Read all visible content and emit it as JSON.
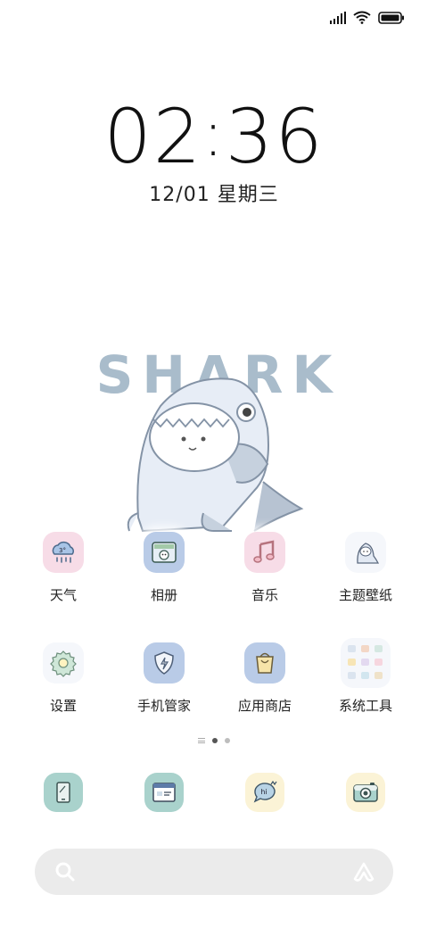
{
  "status_bar": {
    "signal_icon": "cellular-signal-icon",
    "wifi_icon": "wifi-icon",
    "battery_icon": "battery-icon"
  },
  "clock": {
    "hours": "02",
    "minutes": "36"
  },
  "date": "12/01 星期三",
  "wallpaper": {
    "title": "SHARK",
    "colors": {
      "title": "#a9bccb",
      "body": "#dfe7f2",
      "outline": "#8493a6",
      "fin": "#b7c3d2"
    }
  },
  "apps_row1": [
    {
      "label": "天气",
      "icon": "weather-icon"
    },
    {
      "label": "相册",
      "icon": "gallery-icon"
    },
    {
      "label": "音乐",
      "icon": "music-icon"
    },
    {
      "label": "主题壁纸",
      "icon": "themes-icon"
    }
  ],
  "apps_row2": [
    {
      "label": "设置",
      "icon": "settings-icon"
    },
    {
      "label": "手机管家",
      "icon": "security-icon"
    },
    {
      "label": "应用商店",
      "icon": "app-store-icon"
    },
    {
      "label": "系统工具",
      "icon": "system-tools-folder-icon"
    }
  ],
  "dock": [
    {
      "icon": "phone-icon"
    },
    {
      "icon": "messages-icon"
    },
    {
      "icon": "chat-icon",
      "text": "hi"
    },
    {
      "icon": "camera-icon"
    }
  ],
  "page_indicator": {
    "pages": 2,
    "current": 1
  },
  "search": {
    "search_icon": "search-icon",
    "assistant_icon": "assistant-icon"
  }
}
